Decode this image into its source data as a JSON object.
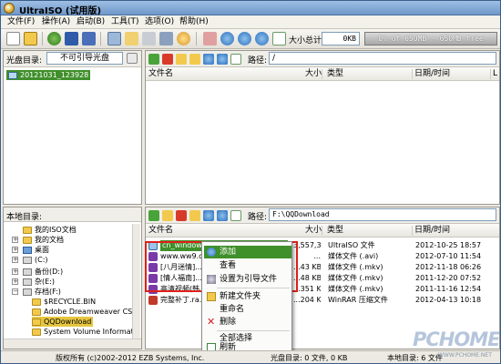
{
  "window": {
    "title": "UltraISO (试用版)"
  },
  "menu": [
    "文件(F)",
    "操作(A)",
    "启动(B)",
    "工具(T)",
    "选项(O)",
    "帮助(H)"
  ],
  "toolbar": {
    "size_label": "大小总计:",
    "size_value": "0KB",
    "capacity_text": "0% of 650MB - 650MB free"
  },
  "image_panel": {
    "label": "光盘目录:",
    "boot_value": "不可引导光盘",
    "path_label": "路径:",
    "path_value": "/",
    "tree_root": "20121031_123928",
    "columns": [
      "文件名",
      "大小",
      "类型",
      "日期/时间",
      "L"
    ]
  },
  "local_panel": {
    "label": "本地目录:",
    "path_label": "路径:",
    "path_value": "F:\\QQDownload",
    "tree": [
      "我的ISO文档",
      "我的文档",
      "桌面",
      "(C:)",
      "备份(D:)",
      "杂(E:)",
      "存档(F:)",
      "$RECYCLE.BIN",
      "Adobe Dreamweaver CS3",
      "QQDownload",
      "System Volume Informat"
    ],
    "columns": [
      "文件名",
      "大小",
      "类型",
      "日期/时间"
    ],
    "files": [
      {
        "name": "cn_windows_8...",
        "size": "3,557,33...",
        "type": "UltraISO 文件",
        "date": "2012-10-25 18:57"
      },
      {
        "name": "www.ww9.cc...",
        "size": "...",
        "type": "媒体文件 (.avi)",
        "date": "2012-07-10 11:54"
      },
      {
        "name": "[八月迷情]...",
        "size": "...43 KB",
        "type": "媒体文件 (.mkv)",
        "date": "2012-11-18 06:26"
      },
      {
        "name": "[情人福南]...",
        "size": "...48 KB",
        "type": "媒体文件 (.mkv)",
        "date": "2011-12-20 07:52"
      },
      {
        "name": "高清视频(韩...",
        "size": "...351 KB",
        "type": "媒体文件 (.mkv)",
        "date": "2011-11-16 12:54"
      },
      {
        "name": "完整补丁.ra...",
        "size": "...204 KB",
        "type": "WinRAR 压缩文件",
        "date": "2012-04-13 10:18"
      }
    ]
  },
  "context_menu": [
    "添加",
    "查看",
    "设置为引导文件",
    "新建文件夹",
    "重命名",
    "删除",
    "全部选择",
    "刷新"
  ],
  "status": {
    "copyright": "版权所有 (c)2002-2012 EZB Systems, Inc.",
    "image_summary": "光盘目录: 0 文件, 0 KB",
    "local_summary": "本地目录: 6 文件"
  },
  "watermark": {
    "brand": "PCHOME",
    "url": "WWW.PCHOME.NET"
  },
  "colors": {
    "accent_red": "#e0201a",
    "selection": "#3f8f2a",
    "title_bar": "#7fa6d4"
  }
}
